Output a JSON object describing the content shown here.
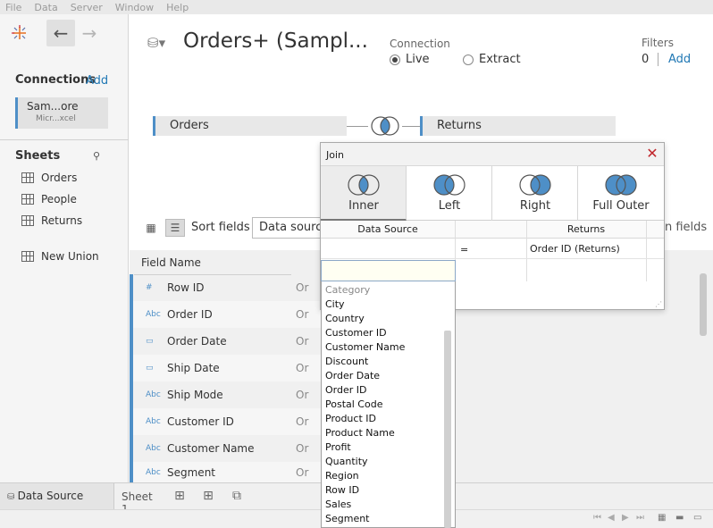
{
  "menu": [
    "File",
    "Data",
    "Server",
    "Window",
    "Help"
  ],
  "left": {
    "connections_title": "Connections",
    "connections_add": "Add",
    "connection_name": "Sam...ore",
    "connection_sub": "Micr...xcel",
    "sheets_title": "Sheets",
    "sheets": [
      "Orders",
      "People",
      "Returns"
    ],
    "new_union": "New Union"
  },
  "header": {
    "title": "Orders+ (Sampl...",
    "connection_label": "Connection",
    "live": "Live",
    "extract": "Extract",
    "filters_label": "Filters",
    "filters_count": "0",
    "filters_add": "Add"
  },
  "canvas": {
    "left_table": "Orders",
    "right_table": "Returns"
  },
  "toolbar": {
    "sort_label": "Sort fields",
    "sort_value": "Data source order",
    "fields_text": "n fields"
  },
  "grid": {
    "header": "Field Name",
    "rows": [
      {
        "type": "#",
        "name": "Row ID",
        "orig": "Or"
      },
      {
        "type": "Abc",
        "name": "Order ID",
        "orig": "Or"
      },
      {
        "type": "cal",
        "name": "Order Date",
        "orig": "Or"
      },
      {
        "type": "cal",
        "name": "Ship Date",
        "orig": "Or"
      },
      {
        "type": "Abc",
        "name": "Ship Mode",
        "orig": "Or"
      },
      {
        "type": "Abc",
        "name": "Customer ID",
        "orig": "Or"
      },
      {
        "type": "Abc",
        "name": "Customer Name",
        "orig": "Or"
      },
      {
        "type": "Abc",
        "name": "Segment",
        "orig": "Or"
      }
    ]
  },
  "join_dialog": {
    "title": "Join",
    "types": [
      "Inner",
      "Left",
      "Right",
      "Full Outer"
    ],
    "selected": "Inner",
    "col_left": "Data Source",
    "col_right": "Returns",
    "operator": "=",
    "right_field": "Order ID (Returns)"
  },
  "picker": {
    "hint": "Category",
    "items": [
      "City",
      "Country",
      "Customer ID",
      "Customer Name",
      "Discount",
      "Order Date",
      "Order ID",
      "Postal Code",
      "Product ID",
      "Product Name",
      "Profit",
      "Quantity",
      "Region",
      "Row ID",
      "Sales",
      "Segment"
    ]
  },
  "tabs": {
    "data_source": "Data Source",
    "sheet1": "Sheet 1"
  },
  "colors": {
    "accent": "#4e8fc7",
    "link": "#1f77b4",
    "close": "#c1272d"
  }
}
